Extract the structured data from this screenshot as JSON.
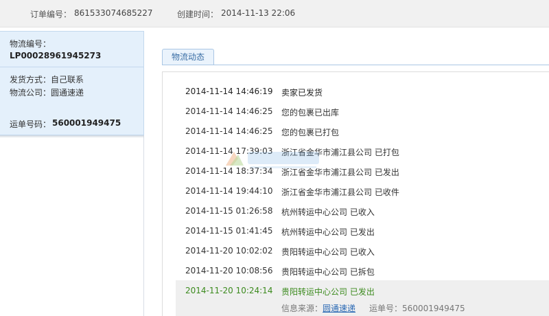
{
  "order": {
    "number_label": "订单编号：",
    "number": "861533074685227",
    "created_label": "创建时间：",
    "created": "2014-11-13 22:06"
  },
  "shipment": {
    "logistics_no_label": "物流编号：",
    "logistics_no": "LP00028961945273",
    "ship_method_label": "发货方式：",
    "ship_method": "自己联系",
    "company_label": "物流公司：",
    "company": "圆通速递",
    "waybill_label": "运单号码：",
    "waybill": "560001949475"
  },
  "tabs": [
    {
      "label": "物流动态"
    }
  ],
  "events": [
    {
      "time": "2014-11-14 14:46:19",
      "desc": "卖家已发货"
    },
    {
      "time": "2014-11-14 14:46:25",
      "desc": "您的包裹已出库"
    },
    {
      "time": "2014-11-14 14:46:25",
      "desc": "您的包裹已打包"
    },
    {
      "time": "2014-11-14 17:39:03",
      "desc": "浙江省金华市浦江县公司 已打包"
    },
    {
      "time": "2014-11-14 18:37:34",
      "desc": "浙江省金华市浦江县公司 已发出"
    },
    {
      "time": "2014-11-14 19:44:10",
      "desc": "浙江省金华市浦江县公司 已收件"
    },
    {
      "time": "2014-11-15 01:26:58",
      "desc": "杭州转运中心公司 已收入"
    },
    {
      "time": "2014-11-15 01:41:45",
      "desc": "杭州转运中心公司 已发出"
    },
    {
      "time": "2014-11-20 10:02:02",
      "desc": "贵阳转运中心公司 已收入"
    },
    {
      "time": "2014-11-20 10:08:56",
      "desc": "贵阳转运中心公司 已拆包"
    },
    {
      "time": "2014-11-20 10:24:14",
      "desc": "贵阳转运中心公司 已发出"
    }
  ],
  "source": {
    "label": "信息来源：",
    "company": "圆通速递",
    "waybill_label": "运单号：",
    "waybill": "560001949475"
  },
  "colors": {
    "latest_event": "#3b8a1d",
    "link": "#2d6bb5",
    "sidebar_bg": "#e4f0fb"
  }
}
